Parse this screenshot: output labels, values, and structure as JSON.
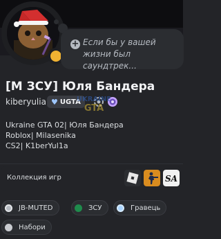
{
  "profile": {
    "display_name": "[М ЗСУ] Юля Бандера",
    "username": "kiberyulia",
    "guild_tag": "UGTA",
    "note_placeholder": "Если бы у вашей жизни был саундтрек...",
    "status_color": "#f0b232",
    "bio_lines": [
      "Ukraine GTA 02| Юля Бандера",
      "Roblox| Milasenika",
      "CS2| K1berYul1a"
    ]
  },
  "watermark": {
    "top": "UKRAINE",
    "bottom": "GTA"
  },
  "games": {
    "label": "Коллекция игр",
    "items": [
      "roblox-icon",
      "counter-strike-icon",
      "gta-san-andreas-icon"
    ]
  },
  "roles": [
    {
      "label": "JB-MUTED",
      "color": "#b5bac1"
    },
    {
      "label": "ЗСУ",
      "color": "#1f8b4c"
    },
    {
      "label": "Гравець",
      "color": "#aad4ff"
    },
    {
      "label": "Набори",
      "color": "#c9cbd0"
    }
  ]
}
